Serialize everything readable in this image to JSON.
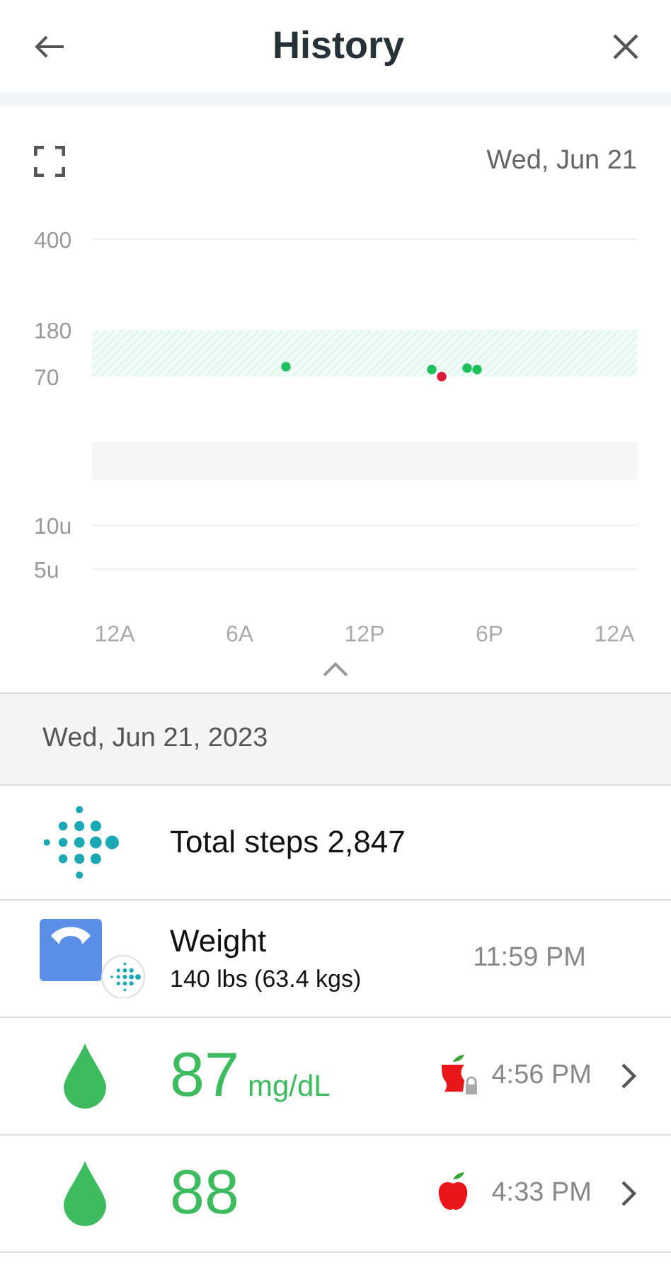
{
  "header": {
    "title": "History"
  },
  "chart": {
    "date": "Wed, Jun 21",
    "y_labels": [
      "400",
      "180",
      "70",
      "10u",
      "5u"
    ],
    "x_labels": [
      "12A",
      "6A",
      "12P",
      "6P",
      "12A"
    ]
  },
  "day": {
    "date": "Wed, Jun 21, 2023"
  },
  "entries": [
    {
      "kind": "steps",
      "label": "Total steps 2,847"
    },
    {
      "kind": "weight",
      "label": "Weight",
      "detail": "140 lbs (63.4 kgs)",
      "time": "11:59 PM"
    },
    {
      "kind": "glucose",
      "value": "87",
      "unit": "mg/dL",
      "color": "#3dbb5e",
      "bitten": true,
      "locked": true,
      "time": "4:56 PM"
    },
    {
      "kind": "glucose",
      "value": "88",
      "color": "#3dbb5e",
      "bitten": false,
      "locked": false,
      "time": "4:33 PM"
    }
  ]
}
